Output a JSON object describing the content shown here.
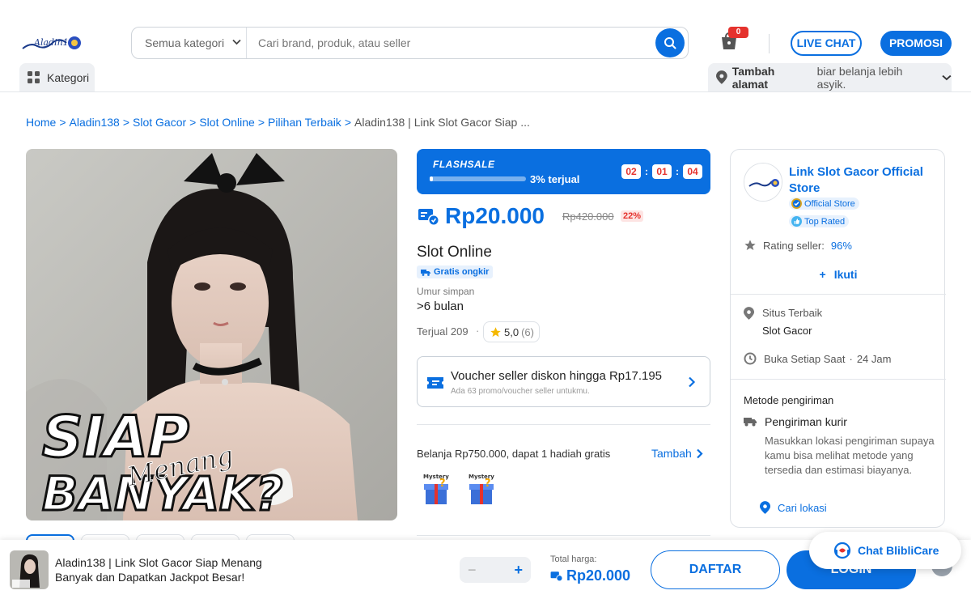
{
  "colors": {
    "brand": "#0a6fe0",
    "danger": "#e5322d"
  },
  "header": {
    "logo_text": "Aladin138",
    "category_select": "Semua kategori",
    "search_placeholder": "Cari brand, produk, atau seller",
    "cart_count": "0",
    "live_chat": "LIVE CHAT",
    "promo": "PROMOSI",
    "kategori": "Kategori",
    "address_strong": "Tambah alamat",
    "address_rest": "biar belanja lebih asyik."
  },
  "breadcrumb": {
    "items": [
      "Home",
      "Aladin138",
      "Slot Gacor",
      "Slot Online",
      "Pilihan Terbaik"
    ],
    "current": "Aladin138 | Link Slot Gacor Siap ...",
    "separator": ">"
  },
  "product_image": {
    "line1": "SIAP",
    "script": "Menang",
    "line2": "BANYAK?"
  },
  "flash_sale": {
    "title": "FLASHSALE",
    "sold_text": "3% terjual",
    "sold_fraction": 0.03,
    "timer": [
      "02",
      "01",
      "04"
    ]
  },
  "product": {
    "price": "Rp20.000",
    "original_price": "Rp420.000",
    "discount": "22%",
    "name": "Slot Online",
    "shipping_badge": "Gratis ongkir",
    "shelf_label": "Umur simpan",
    "shelf_value": ">6 bulan",
    "sold": "Terjual 209",
    "rating": "5,0",
    "rating_count": "(6)"
  },
  "voucher": {
    "title": "Voucher seller diskon hingga Rp17.195",
    "subtitle": "Ada 63 promo/voucher seller untukmu."
  },
  "gift": {
    "text": "Belanja Rp750.000, dapat 1 hadiah gratis",
    "add_label": "Tambah",
    "box_label": "Mystery Box"
  },
  "store": {
    "name": "Link Slot Gacor Official Store",
    "badge_official": "Official Store",
    "badge_top": "Top Rated",
    "rating_label": "Rating seller:",
    "rating_value": "96%",
    "follow": "Ikuti",
    "location_label": "Situs Terbaik",
    "location_value": "Slot Gacor",
    "hours_label": "Buka Setiap Saat",
    "hours_value": "24 Jam",
    "shipping_title": "Metode pengiriman",
    "shipping_heading": "Pengiriman kurir",
    "shipping_desc": "Masukkan lokasi pengiriman supaya kamu bisa melihat metode yang tersedia dan estimasi biayanya.",
    "find_location": "Cari lokasi"
  },
  "bottom_bar": {
    "title": "Aladin138 | Link Slot Gacor Siap Menang Banyak dan Dapatkan Jackpot Besar!",
    "minus": "−",
    "plus": "+",
    "total_label": "Total harga:",
    "total_value": "Rp20.000",
    "register": "DAFTAR",
    "login": "LOGIN"
  },
  "chat_widget": {
    "label": "Chat BlibliCare"
  }
}
